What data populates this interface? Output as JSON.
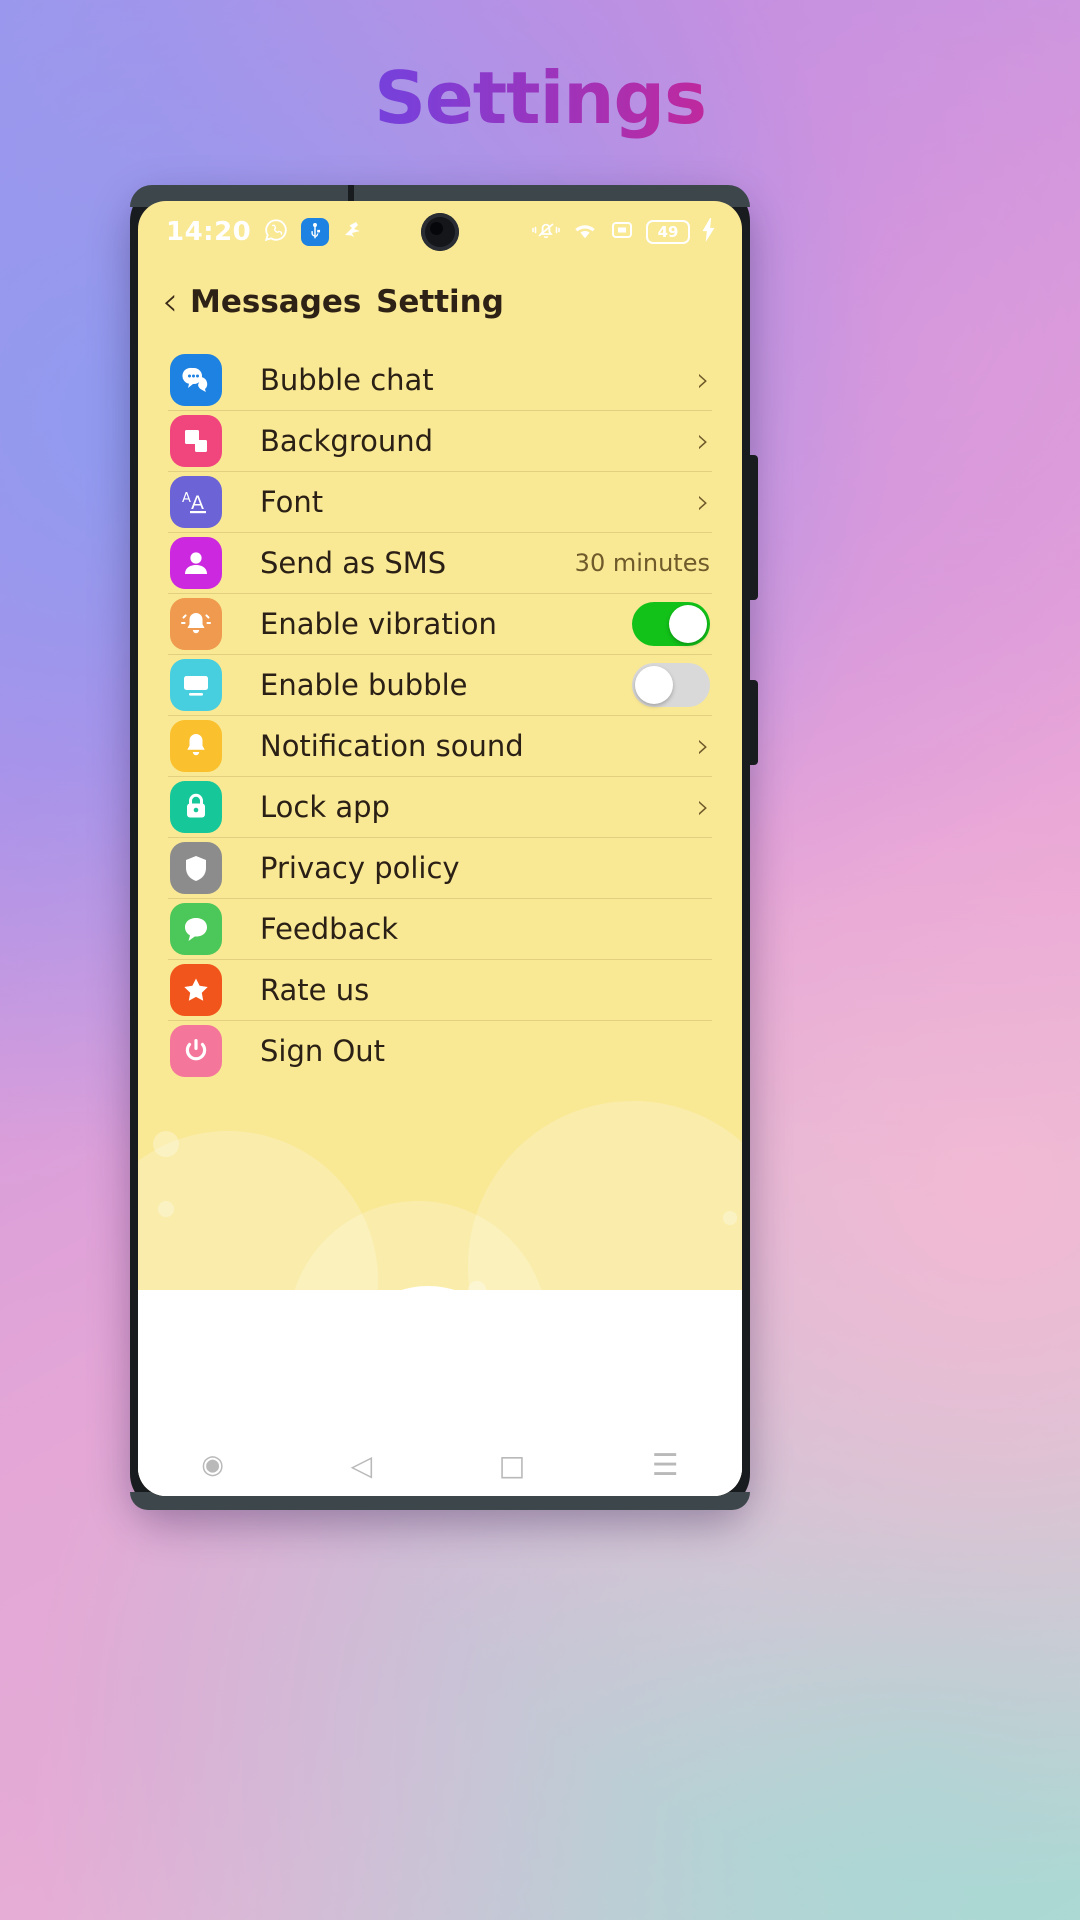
{
  "page": {
    "title": "Settings"
  },
  "statusbar": {
    "time": "14:20",
    "battery_level": "49",
    "icons": [
      "whatsapp-icon",
      "usb-icon",
      "bluetooth-share-icon",
      "camera-punchhole",
      "mute-icon",
      "wifi-icon",
      "sim-icon",
      "battery-icon",
      "charging-bolt-icon"
    ]
  },
  "header": {
    "back_chevron": "‹",
    "back_label": "Messages",
    "title": "Setting"
  },
  "list": {
    "chevron": "›",
    "items": [
      {
        "label": "Bubble chat",
        "icon": "bubble-chat-icon",
        "icon_color": "#1d82e2",
        "control": "chevron",
        "value": ""
      },
      {
        "label": "Background",
        "icon": "background-icon",
        "icon_color": "#f1457e",
        "control": "chevron",
        "value": ""
      },
      {
        "label": "Font",
        "icon": "font-icon",
        "icon_color": "#6b63d6",
        "control": "chevron",
        "value": ""
      },
      {
        "label": "Send as SMS",
        "icon": "send-as-sms-icon",
        "icon_color": "#cc28e0",
        "control": "value",
        "value": "30 minutes"
      },
      {
        "label": "Enable vibration",
        "icon": "vibration-bell-icon",
        "icon_color": "#ef9a4e",
        "control": "toggle-on",
        "value": ""
      },
      {
        "label": "Enable bubble",
        "icon": "bubble-window-icon",
        "icon_color": "#47cfe0",
        "control": "toggle-off",
        "value": ""
      },
      {
        "label": "Notification sound",
        "icon": "notification-bell-icon",
        "icon_color": "#fbc02d",
        "control": "chevron",
        "value": ""
      },
      {
        "label": "Lock app",
        "icon": "lock-icon",
        "icon_color": "#16c79a",
        "control": "chevron",
        "value": ""
      },
      {
        "label": "Privacy policy",
        "icon": "shield-icon",
        "icon_color": "#8c8c8c",
        "control": "none",
        "value": ""
      },
      {
        "label": "Feedback",
        "icon": "feedback-chat-icon",
        "icon_color": "#4cc85a",
        "control": "none",
        "value": ""
      },
      {
        "label": "Rate us",
        "icon": "star-icon",
        "icon_color": "#f1551c",
        "control": "none",
        "value": ""
      },
      {
        "label": "Sign Out",
        "icon": "power-icon",
        "icon_color": "#f4779b",
        "control": "none",
        "value": ""
      }
    ]
  },
  "navbar": {
    "items": [
      {
        "name": "assistant-button",
        "glyph": "◉"
      },
      {
        "name": "back-button",
        "glyph": "◁"
      },
      {
        "name": "home-button",
        "glyph": "□"
      },
      {
        "name": "recents-button",
        "glyph": "☰"
      }
    ]
  },
  "colors": {
    "screen_bg": "#f9e894",
    "toggle_on": "#12c219",
    "toggle_off": "#d9d9d9",
    "text": "#2b2015"
  }
}
